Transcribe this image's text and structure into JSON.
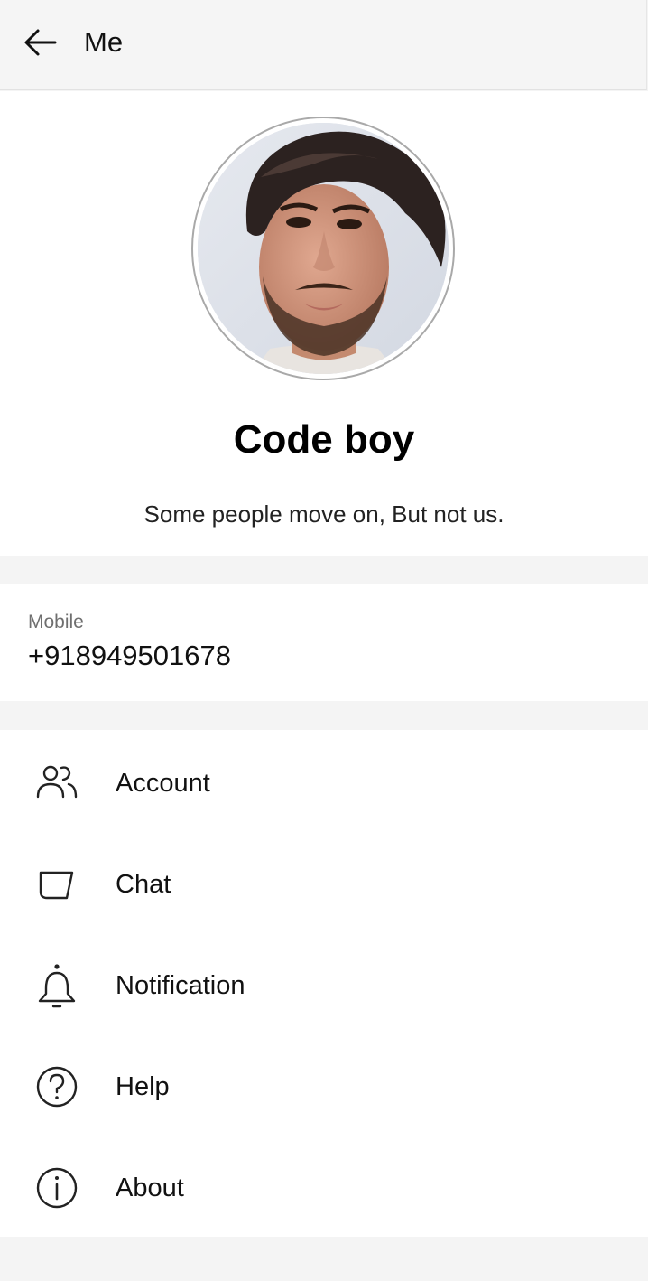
{
  "header": {
    "title": "Me",
    "back_icon": "arrow-left-icon"
  },
  "profile": {
    "name": "Code boy",
    "status": "Some people move on, But not us."
  },
  "mobile": {
    "label": "Mobile",
    "value": "+918949501678"
  },
  "menu": {
    "items": [
      {
        "label": "Account",
        "icon": "users-icon"
      },
      {
        "label": "Chat",
        "icon": "chat-icon"
      },
      {
        "label": "Notification",
        "icon": "bell-icon"
      },
      {
        "label": "Help",
        "icon": "help-icon"
      },
      {
        "label": "About",
        "icon": "info-icon"
      }
    ]
  },
  "colors": {
    "background": "#f4f4f4",
    "surface": "#ffffff",
    "text": "#111111",
    "muted": "#6f6f6f"
  }
}
